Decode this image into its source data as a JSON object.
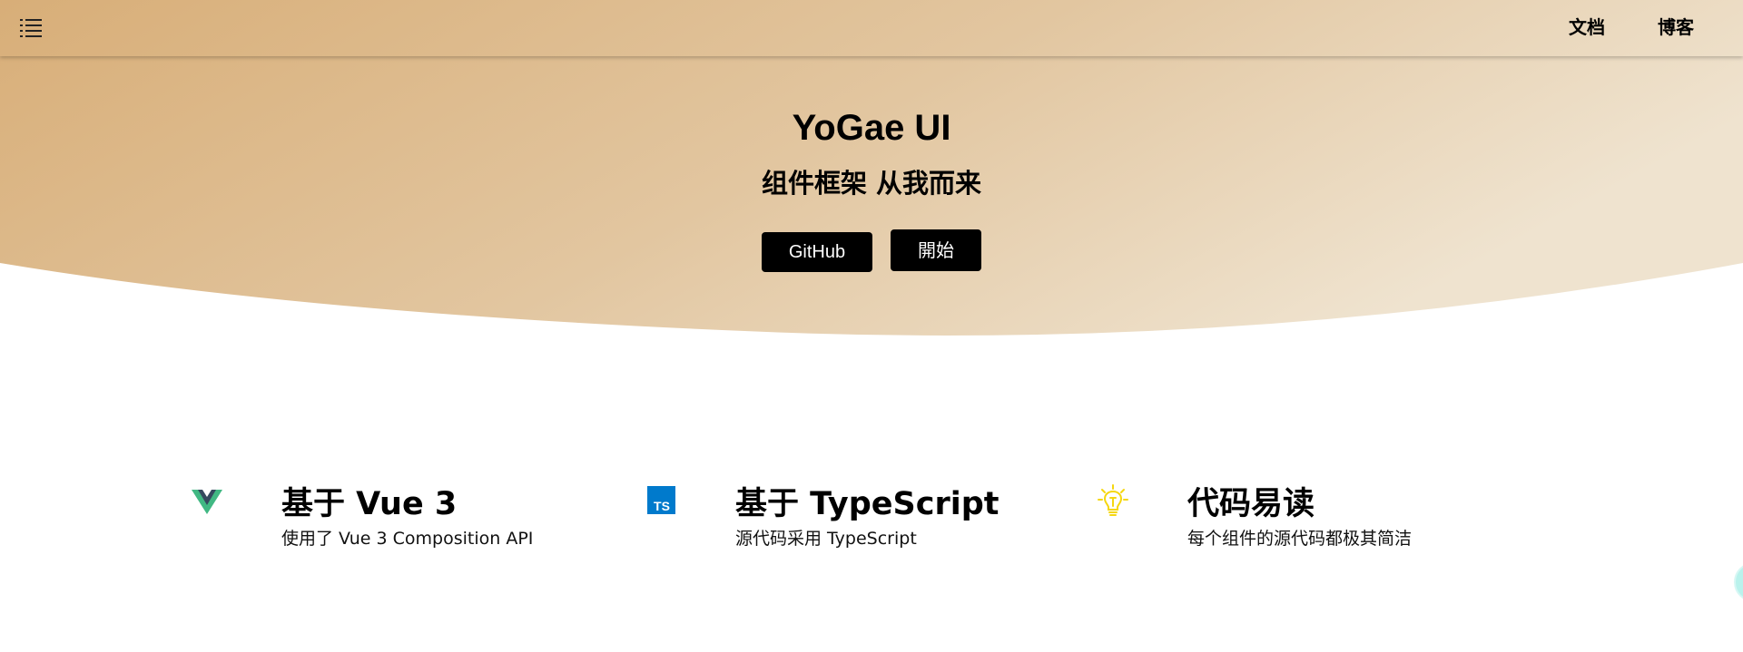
{
  "colors": {
    "gradient_start": "#d8ae78",
    "gradient_end": "#efe3cf",
    "button_bg": "#000000",
    "button_text": "#ffffff",
    "vue_green": "#41b883",
    "vue_dark": "#35495e",
    "ts_blue": "#007acc",
    "bulb_yellow": "#f5d70f",
    "bubble": "#b9f2ec"
  },
  "nav": {
    "menu_icon": "menu-list-icon",
    "links": [
      {
        "label": "文档"
      },
      {
        "label": "博客"
      }
    ]
  },
  "hero": {
    "title": "YoGae UI",
    "subtitle": "组件框架 从我而来",
    "buttons": [
      {
        "label": "GitHub"
      },
      {
        "label": "開始"
      }
    ]
  },
  "features": [
    {
      "icon": "vue-logo-icon",
      "title": "基于 Vue 3",
      "desc": "使用了 Vue 3 Composition API"
    },
    {
      "icon": "typescript-logo-icon",
      "title": "基于 TypeScript",
      "desc": "源代码采用 TypeScript"
    },
    {
      "icon": "lightbulb-icon",
      "title": "代码易读",
      "desc": "每个组件的源代码都极其简洁"
    }
  ]
}
